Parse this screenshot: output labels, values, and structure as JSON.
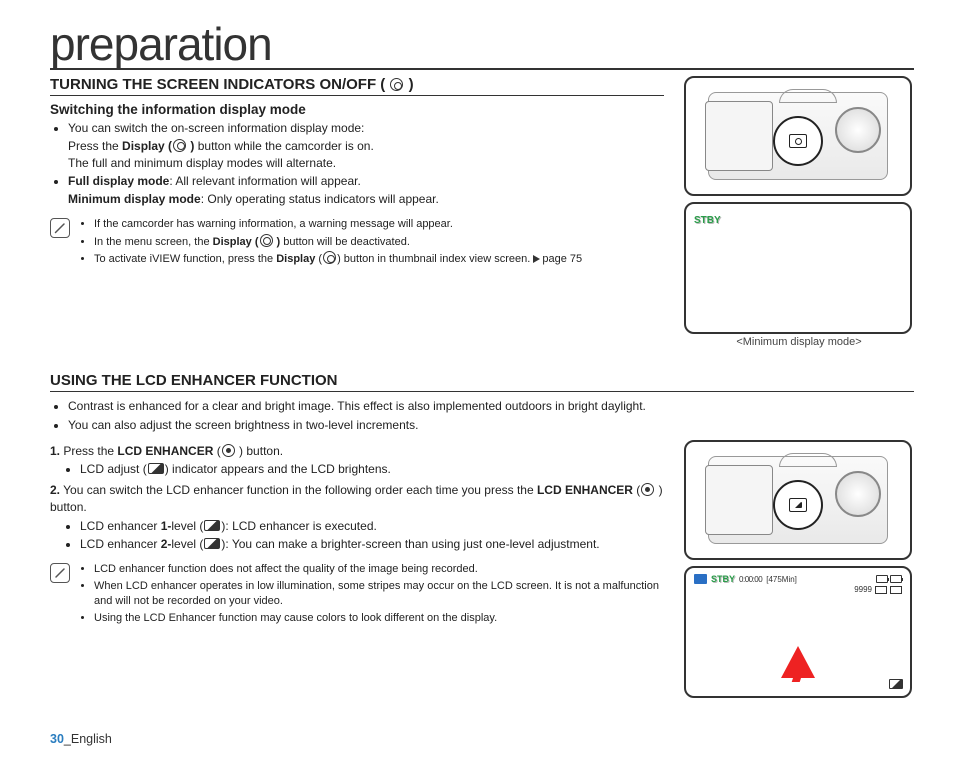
{
  "page_title": "preparation",
  "section1": {
    "heading_prefix": "TURNING THE SCREEN INDICATORS ON/OFF (",
    "heading_suffix": " )",
    "sub_heading": "Switching the information display mode",
    "b1_line1": "You can switch the on-screen information display mode:",
    "b1_line2a": "Press the ",
    "b1_line2b": "Display (",
    "b1_line2c": " )",
    "b1_line2d": " button while the camcorder is on.",
    "b1_line3": "The full and minimum display modes will alternate.",
    "b2a": "Full display mode",
    "b2b": ": All relevant information will appear.",
    "b3a": "Minimum display mode",
    "b3b": ": Only operating status indicators will appear.",
    "note1_1": "If the camcorder has warning information, a warning message will appear.",
    "note1_2a": "In the menu screen, the ",
    "note1_2b": "Display (",
    "note1_2c": " )",
    "note1_2d": " button will be deactivated.",
    "note1_3a": "To activate iVIEW function, press the ",
    "note1_3b": "Display",
    "note1_3c": " (",
    "note1_3d": ") button in thumbnail index view screen. ",
    "note1_3e": "page 75"
  },
  "fig1_caption": "<Minimum display mode>",
  "stby": "STBY",
  "section2": {
    "heading": "USING THE LCD ENHANCER FUNCTION",
    "intro1": "Contrast is enhanced for a clear and bright image. This effect is also implemented outdoors in bright daylight.",
    "intro2": "You can also adjust the screen brightness in two-level increments.",
    "step1_num": "1.",
    "step1_a": " Press the ",
    "step1_b": "LCD ENHANCER",
    "step1_c": " (",
    "step1_d": " ) button.",
    "step1_sub_a": "LCD adjust (",
    "step1_sub_b": ") indicator appears and the LCD brightens.",
    "step2_num": "2.",
    "step2_a": " You can switch the LCD enhancer function in the following order each time you press the ",
    "step2_b": "LCD ENHANCER",
    "step2_c": " (",
    "step2_d": " ) button.",
    "step2_sub1_a": "LCD enhancer ",
    "step2_sub1_b": "1-",
    "step2_sub1_c": "level (",
    "step2_sub1_d": "): LCD enhancer is executed.",
    "step2_sub2_a": "LCD enhancer ",
    "step2_sub2_b": "2-",
    "step2_sub2_c": "level (",
    "step2_sub2_d": "): You can make a brighter-screen than using just one-level adjustment.",
    "note2_1": "LCD enhancer function does not affect the quality of the image being recorded.",
    "note2_2": "When LCD enhancer operates in low illumination, some stripes may occur on the LCD screen. It is not a malfunction and will not be recorded on your video.",
    "note2_3": "Using the LCD Enhancer function may cause colors to look different on the display."
  },
  "lcd2": {
    "stby": "STBY",
    "timecode": "0:00:00",
    "remain": "[475Min]",
    "count": "9999"
  },
  "footer": {
    "page": "30",
    "sep": "_",
    "lang": "English"
  }
}
